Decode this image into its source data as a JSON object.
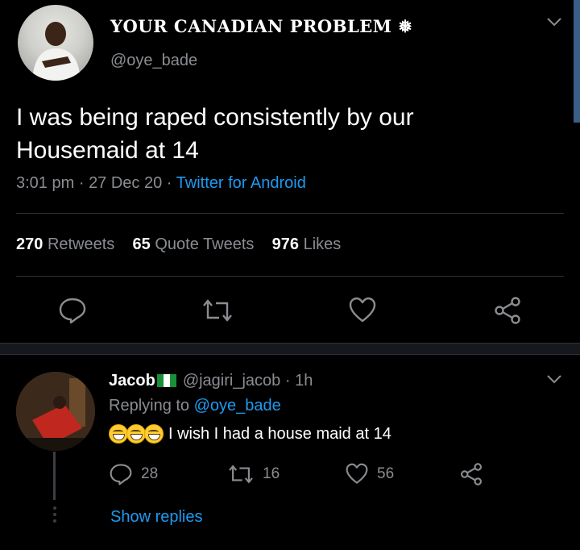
{
  "tweet": {
    "display_name": "YOUR CANADIAN PROBLEM ❅",
    "handle": "@oye_bade",
    "text": "I was being raped consistently by our Housemaid at 14",
    "time": "3:01 pm",
    "date": "27 Dec 20",
    "sep": "·",
    "source": "Twitter for Android",
    "stats": {
      "retweets_count": "270",
      "retweets_label": "Retweets",
      "quotes_count": "65",
      "quotes_label": "Quote Tweets",
      "likes_count": "976",
      "likes_label": "Likes"
    }
  },
  "reply": {
    "name": "Jacob",
    "handle": "@jagiri_jacob",
    "sep": "·",
    "time": "1h",
    "replying_label": "Replying to",
    "replying_handle": "@oye_bade",
    "text": "I wish I had a house maid at 14",
    "reply_count": "28",
    "retweet_count": "16",
    "like_count": "56",
    "show_replies": "Show replies"
  },
  "icons": [
    "chevron-down-icon",
    "reply-icon",
    "retweet-icon",
    "like-icon",
    "share-icon",
    "nigeria-flag-icon",
    "grinning-emoji-icon"
  ],
  "colors": {
    "background": "#000000",
    "link": "#1d9bf0",
    "muted": "#8a8d91",
    "divider": "#2f3336"
  }
}
